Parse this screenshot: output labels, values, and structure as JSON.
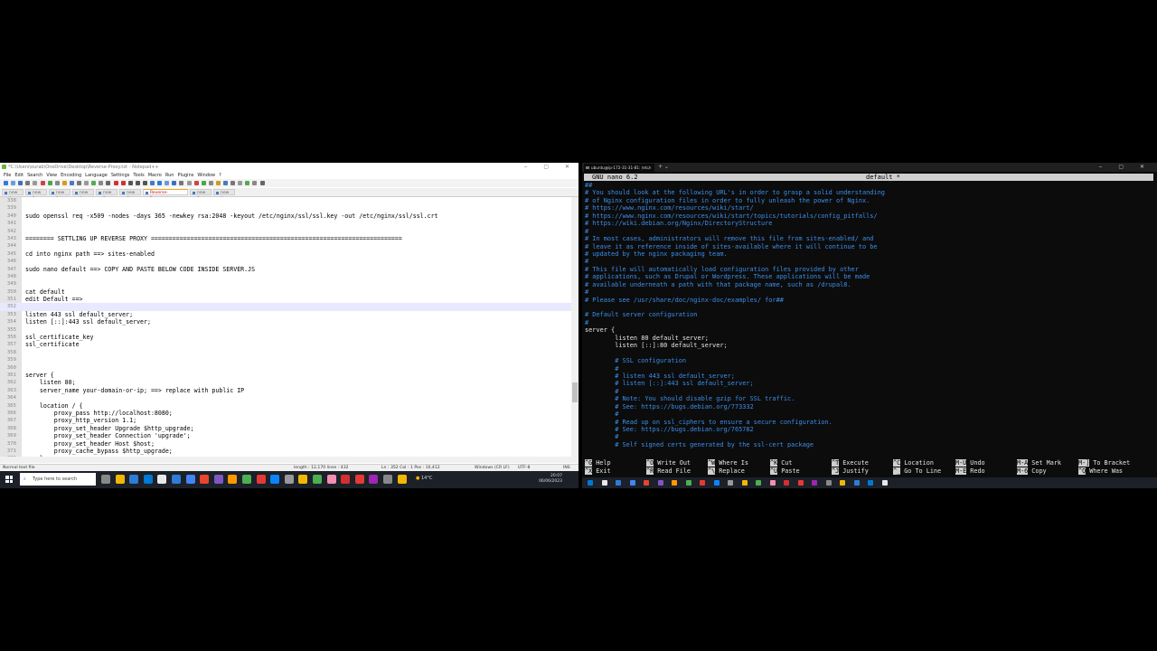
{
  "notepad": {
    "title": "*C:\\Users\\ourab\\OneDrive\\Desktop\\Reverse-Proxy.txt - Notepad++",
    "menu": [
      "File",
      "Edit",
      "Search",
      "View",
      "Encoding",
      "Language",
      "Settings",
      "Tools",
      "Macro",
      "Run",
      "Plugins",
      "Window",
      "?"
    ],
    "tabs": [
      "new 1",
      "new 2",
      "new 3",
      "new 4",
      "new 5",
      "new 6",
      "Reverse-Proxy.txt",
      "new 7",
      "new 8"
    ],
    "active_tab_index": 6,
    "lines": [
      {
        "num": "338",
        "text": ""
      },
      {
        "num": "339",
        "text": ""
      },
      {
        "num": "340",
        "text": "sudo openssl req -x509 -nodes -days 365 -newkey rsa:2048 -keyout /etc/nginx/ssl/ssl.key -out /etc/nginx/ssl/ssl.crt"
      },
      {
        "num": "341",
        "text": ""
      },
      {
        "num": "342",
        "text": ""
      },
      {
        "num": "343",
        "text": "======== SETTLING UP REVERSE PROXY ======================================================================"
      },
      {
        "num": "344",
        "text": ""
      },
      {
        "num": "345",
        "text": "cd into nginx path ==> sites-enabled"
      },
      {
        "num": "346",
        "text": ""
      },
      {
        "num": "347",
        "text": "sudo nano default ==> COPY AND PASTE BELOW CODE INSIDE SERVER.JS"
      },
      {
        "num": "348",
        "text": ""
      },
      {
        "num": "349",
        "text": ""
      },
      {
        "num": "350",
        "text": "cat default"
      },
      {
        "num": "351",
        "text": "edit Default ==>"
      },
      {
        "num": "352",
        "text": ""
      },
      {
        "num": "353",
        "text": "listen 443 ssl default_server;"
      },
      {
        "num": "354",
        "text": "listen [::]:443 ssl default_server;"
      },
      {
        "num": "355",
        "text": ""
      },
      {
        "num": "356",
        "text": "ssl_certificate_key"
      },
      {
        "num": "357",
        "text": "ssl_certificate"
      },
      {
        "num": "358",
        "text": ""
      },
      {
        "num": "359",
        "text": ""
      },
      {
        "num": "360",
        "text": ""
      },
      {
        "num": "361",
        "text": "server {"
      },
      {
        "num": "362",
        "text": "    listen 80;"
      },
      {
        "num": "363",
        "text": "    server_name your-domain-or-ip; ==> replace with public IP"
      },
      {
        "num": "364",
        "text": ""
      },
      {
        "num": "365",
        "text": "    location / {"
      },
      {
        "num": "366",
        "text": "        proxy_pass http://localhost:8080;"
      },
      {
        "num": "367",
        "text": "        proxy_http_version 1.1;"
      },
      {
        "num": "368",
        "text": "        proxy_set_header Upgrade $http_upgrade;"
      },
      {
        "num": "369",
        "text": "        proxy_set_header Connection 'upgrade';"
      },
      {
        "num": "370",
        "text": "        proxy_set_header Host $host;"
      },
      {
        "num": "371",
        "text": "        proxy_cache_bypass $http_upgrade;"
      },
      {
        "num": "372",
        "text": "    }"
      }
    ],
    "current_line_index": 14,
    "status": {
      "type": "Normal text file",
      "length": "length : 12,170    lines : 432",
      "position": "Ln : 352    Col : 1    Pos : 10,412",
      "eol": "Windows (CR LF)",
      "encoding": "UTF-8",
      "mode": "INS"
    }
  },
  "taskbar_left": {
    "search_placeholder": "Type here to search",
    "weather": "14°C",
    "time": "20:07",
    "date": "06/06/2023"
  },
  "terminal": {
    "tab_title": "ubuntu@ip-172-31-31-81: /etc/",
    "nano_version": "GNU nano 6.2",
    "file_name": "default *",
    "lines": [
      {
        "t": "##",
        "c": true
      },
      {
        "t": "# You should look at the following URL's in order to grasp a solid understanding",
        "c": true
      },
      {
        "t": "# of Nginx configuration files in order to fully unleash the power of Nginx.",
        "c": true
      },
      {
        "t": "# https://www.nginx.com/resources/wiki/start/",
        "c": true
      },
      {
        "t": "# https://www.nginx.com/resources/wiki/start/topics/tutorials/config_pitfalls/",
        "c": true
      },
      {
        "t": "# https://wiki.debian.org/Nginx/DirectoryStructure",
        "c": true
      },
      {
        "t": "#",
        "c": true
      },
      {
        "t": "# In most cases, administrators will remove this file from sites-enabled/ and",
        "c": true
      },
      {
        "t": "# leave it as reference inside of sites-available where it will continue to be",
        "c": true
      },
      {
        "t": "# updated by the nginx packaging team.",
        "c": true
      },
      {
        "t": "#",
        "c": true
      },
      {
        "t": "# This file will automatically load configuration files provided by other",
        "c": true
      },
      {
        "t": "# applications, such as Drupal or Wordpress. These applications will be made",
        "c": true
      },
      {
        "t": "# available underneath a path with that package name, such as /drupal8.",
        "c": true
      },
      {
        "t": "#",
        "c": true
      },
      {
        "t": "# Please see /usr/share/doc/nginx-doc/examples/ for##",
        "c": true
      },
      {
        "t": "",
        "c": false
      },
      {
        "t": "# Default server configuration",
        "c": true
      },
      {
        "t": "#",
        "c": true
      },
      {
        "t": "server {",
        "c": false
      },
      {
        "t": "        listen 80 default_server;",
        "c": false
      },
      {
        "t": "        listen [::]:80 default_server;",
        "c": false
      },
      {
        "t": "",
        "c": false
      },
      {
        "t": "        # SSL configuration",
        "c": true
      },
      {
        "t": "        #",
        "c": true
      },
      {
        "t": "        # listen 443 ssl default_server;",
        "c": true
      },
      {
        "t": "        # listen [::]:443 ssl default_server;",
        "c": true
      },
      {
        "t": "        #",
        "c": true
      },
      {
        "t": "        # Note: You should disable gzip for SSL traffic.",
        "c": true
      },
      {
        "t": "        # See: https://bugs.debian.org/773332",
        "c": true
      },
      {
        "t": "        #",
        "c": true
      },
      {
        "t": "        # Read up on ssl_ciphers to ensure a secure configuration.",
        "c": true
      },
      {
        "t": "        # See: https://bugs.debian.org/765782",
        "c": true
      },
      {
        "t": "        #",
        "c": true
      },
      {
        "t": "        # Self signed certs generated by the ssl-cert package",
        "c": true
      }
    ],
    "shortcuts": [
      {
        "k1": "^G",
        "l1": "Help",
        "k2": "^X",
        "l2": "Exit"
      },
      {
        "k1": "^O",
        "l1": "Write Out",
        "k2": "^R",
        "l2": "Read File"
      },
      {
        "k1": "^W",
        "l1": "Where Is",
        "k2": "^\\",
        "l2": "Replace"
      },
      {
        "k1": "^K",
        "l1": "Cut",
        "k2": "^U",
        "l2": "Paste"
      },
      {
        "k1": "^T",
        "l1": "Execute",
        "k2": "^J",
        "l2": "Justify"
      },
      {
        "k1": "^C",
        "l1": "Location",
        "k2": "^_",
        "l2": "Go To Line"
      },
      {
        "k1": "M-U",
        "l1": "Undo",
        "k2": "M-E",
        "l2": "Redo"
      },
      {
        "k1": "M-A",
        "l1": "Set Mark",
        "k2": "M-6",
        "l2": "Copy"
      },
      {
        "k1": "M-]",
        "l1": "To Bracket",
        "k2": "^Q",
        "l2": "Where Was"
      }
    ]
  },
  "colors": {
    "nano_comment": "#3b8eea",
    "nano_text": "#e6e6e6",
    "npp_current_line": "#e8e8ff",
    "taskbar": "#1c2028"
  }
}
